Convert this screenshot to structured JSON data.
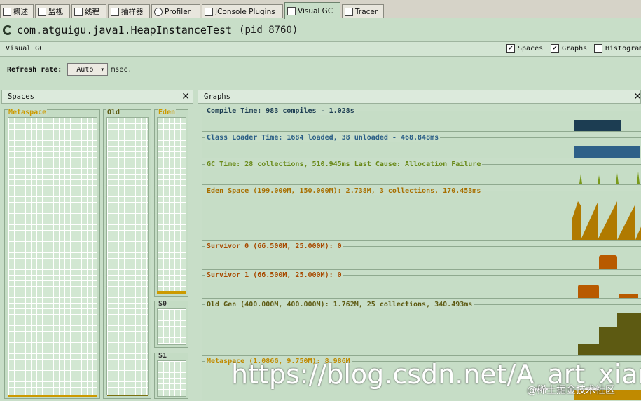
{
  "tabs": [
    {
      "label": "概述"
    },
    {
      "label": "监视"
    },
    {
      "label": "线程"
    },
    {
      "label": "抽样器"
    },
    {
      "label": "Profiler"
    },
    {
      "label": "JConsole Plugins"
    },
    {
      "label": "Visual GC"
    },
    {
      "label": "Tracer"
    }
  ],
  "header": {
    "title": "com.atguigu.java1.HeapInstanceTest",
    "pid": "(pid 8760)"
  },
  "visual_gc_bar": {
    "label": "Visual GC",
    "options": [
      {
        "label": "Spaces",
        "checked": "✔"
      },
      {
        "label": "Graphs",
        "checked": "✔"
      },
      {
        "label": "Histogram",
        "checked": ""
      }
    ]
  },
  "refresh": {
    "label": "Refresh rate:",
    "value": "Auto",
    "unit": "msec."
  },
  "spaces": {
    "title": "Spaces",
    "close": "✕",
    "metaspace": "Metaspace",
    "old": "Old",
    "eden": "Eden",
    "s0": "S0",
    "s1": "S1"
  },
  "graphs": {
    "title": "Graphs",
    "close": "✕",
    "compile": "Compile Time: 983 compiles - 1.028s",
    "class_loader": "Class Loader Time: 1684 loaded, 38 unloaded - 468.848ms",
    "gc_time": "GC Time: 28 collections, 510.945ms Last Cause: Allocation Failure",
    "eden": "Eden Space (199.000M, 150.000M): 2.738M, 3 collections, 170.453ms",
    "survivor0": "Survivor 0 (66.500M, 25.000M): 0",
    "survivor1": "Survivor 1 (66.500M, 25.000M): 0",
    "old_gen": "Old Gen (400.000M, 400.000M): 1.762M, 25 collections, 340.493ms",
    "metaspace": "Metaspace (1.086G, 9.750M): 8.986M"
  },
  "colors": {
    "compile": "#1c3d52",
    "class_loader": "#2e6088",
    "gc": "#7a9a1a",
    "eden": "#b07a00",
    "survivor": "#b85a00",
    "old": "#5d5a12",
    "metaspace": "#c08a00"
  },
  "watermark": {
    "text": "https://blog.csdn.net/A_art_xiang",
    "sub": "@稀土掘金技术社区"
  }
}
